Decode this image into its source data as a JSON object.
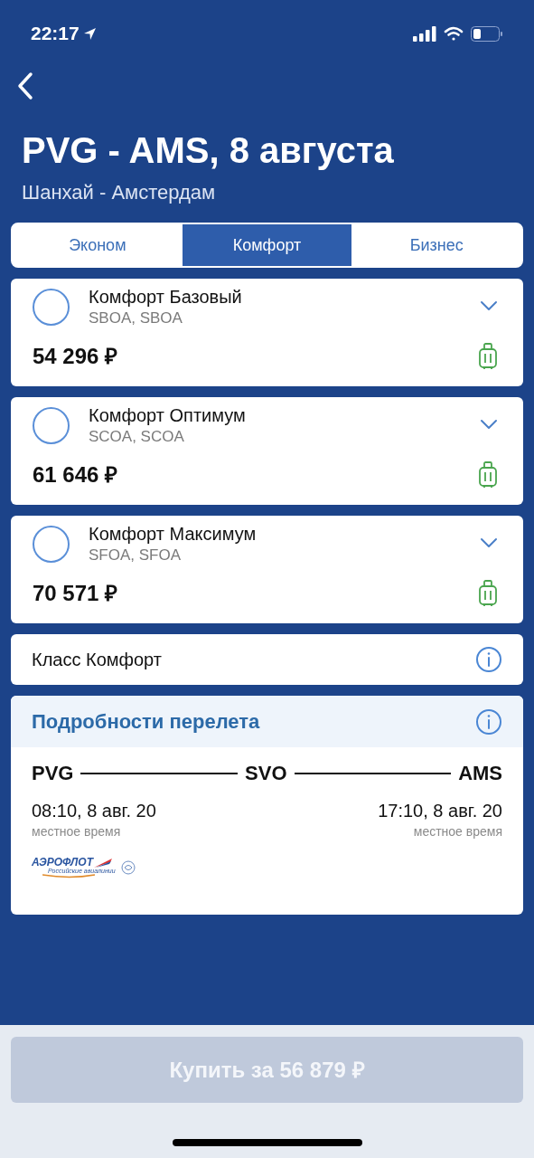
{
  "status_bar": {
    "time": "22:17"
  },
  "header": {
    "title": "PVG - AMS, 8 августа",
    "subtitle": "Шанхай - Амстердам"
  },
  "tabs": [
    {
      "label": "Эконом",
      "selected": false
    },
    {
      "label": "Комфорт",
      "selected": true
    },
    {
      "label": "Бизнес",
      "selected": false
    }
  ],
  "fares": [
    {
      "name": "Комфорт Базовый",
      "codes": "SBOA, SBOA",
      "price": "54 296 ₽",
      "selected": false
    },
    {
      "name": "Комфорт Оптимум",
      "codes": "SCOA, SCOA",
      "price": "61 646 ₽",
      "selected": false
    },
    {
      "name": "Комфорт Максимум",
      "codes": "SFOA, SFOA",
      "price": "70 571 ₽",
      "selected": false
    }
  ],
  "class_info": {
    "label": "Класс Комфорт"
  },
  "flight_details": {
    "title": "Подробности перелета",
    "from": "PVG",
    "via": "SVO",
    "to": "AMS",
    "departure": "08:10, 8 авг. 20",
    "departure_note": "местное время",
    "arrival": "17:10, 8 авг. 20",
    "arrival_note": "местное время",
    "airline": "АЭРОФЛОТ",
    "airline_tagline": "Российские авиалинии"
  },
  "buy_button": {
    "label": "Купить за 56 879 ₽",
    "disabled": true
  }
}
